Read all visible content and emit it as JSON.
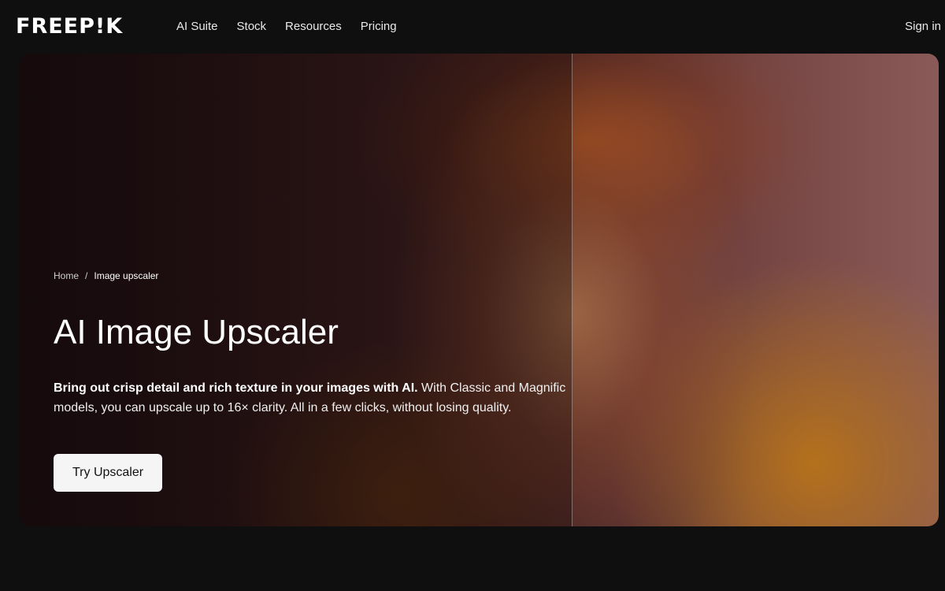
{
  "header": {
    "logo": "FREEP!K",
    "nav": [
      "AI Suite",
      "Stock",
      "Resources",
      "Pricing"
    ],
    "sign_in": "Sign in"
  },
  "breadcrumb": {
    "home": "Home",
    "separator": "/",
    "current": "Image upscaler"
  },
  "hero": {
    "title": "AI Image Upscaler",
    "description_bold": "Bring out crisp detail and rich texture in your images with AI.",
    "description_rest": " With Classic and Magnific models, you can upscale up to 16× clarity. All in a few clicks, without losing quality.",
    "cta": "Try Upscaler"
  }
}
